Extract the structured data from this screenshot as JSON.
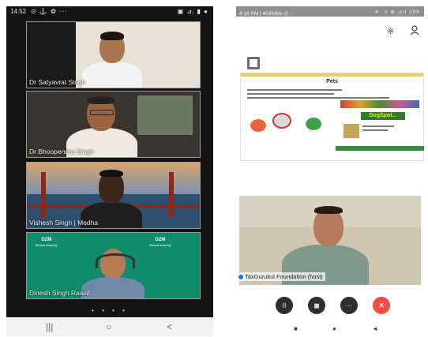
{
  "left_phone": {
    "status_bar": {
      "time": "14:52",
      "left_icons": "⊙ ⚓ ✿ ···",
      "right_icons": "▣ ⊿ᵢ ▮ ●"
    },
    "participants": [
      {
        "name": "Dr Satyavrat Singh"
      },
      {
        "name": "Dr Bhoopendra Singh"
      },
      {
        "name": "Vishesh Singh | Medha"
      },
      {
        "name": "Dinesh Singh Rawat"
      }
    ],
    "logo_text": "G2M",
    "logo_sub": "Medical Academy",
    "page_dots": "• • • •",
    "nav_bar": {
      "recent": "|||",
      "home": "○",
      "back": "<"
    }
  },
  "right_phone": {
    "status_bar": {
      "time": "4:18 PM | 403KB/s ⓦ ···",
      "right_icons": "✶ .ıl ⊛ ⊿ıl 100"
    },
    "bluetooth_icon": "bluetooth-icon",
    "shared_slide": {
      "title": "Pets",
      "badge_text": "DogSpot..."
    },
    "host_label": "TaxGurukul Foundation (host)",
    "controls": {
      "pause": "II",
      "camera": "◼",
      "more": "···",
      "end": "×"
    },
    "nav_bar": {
      "square": "■",
      "circle": "●",
      "back": "◄"
    }
  }
}
